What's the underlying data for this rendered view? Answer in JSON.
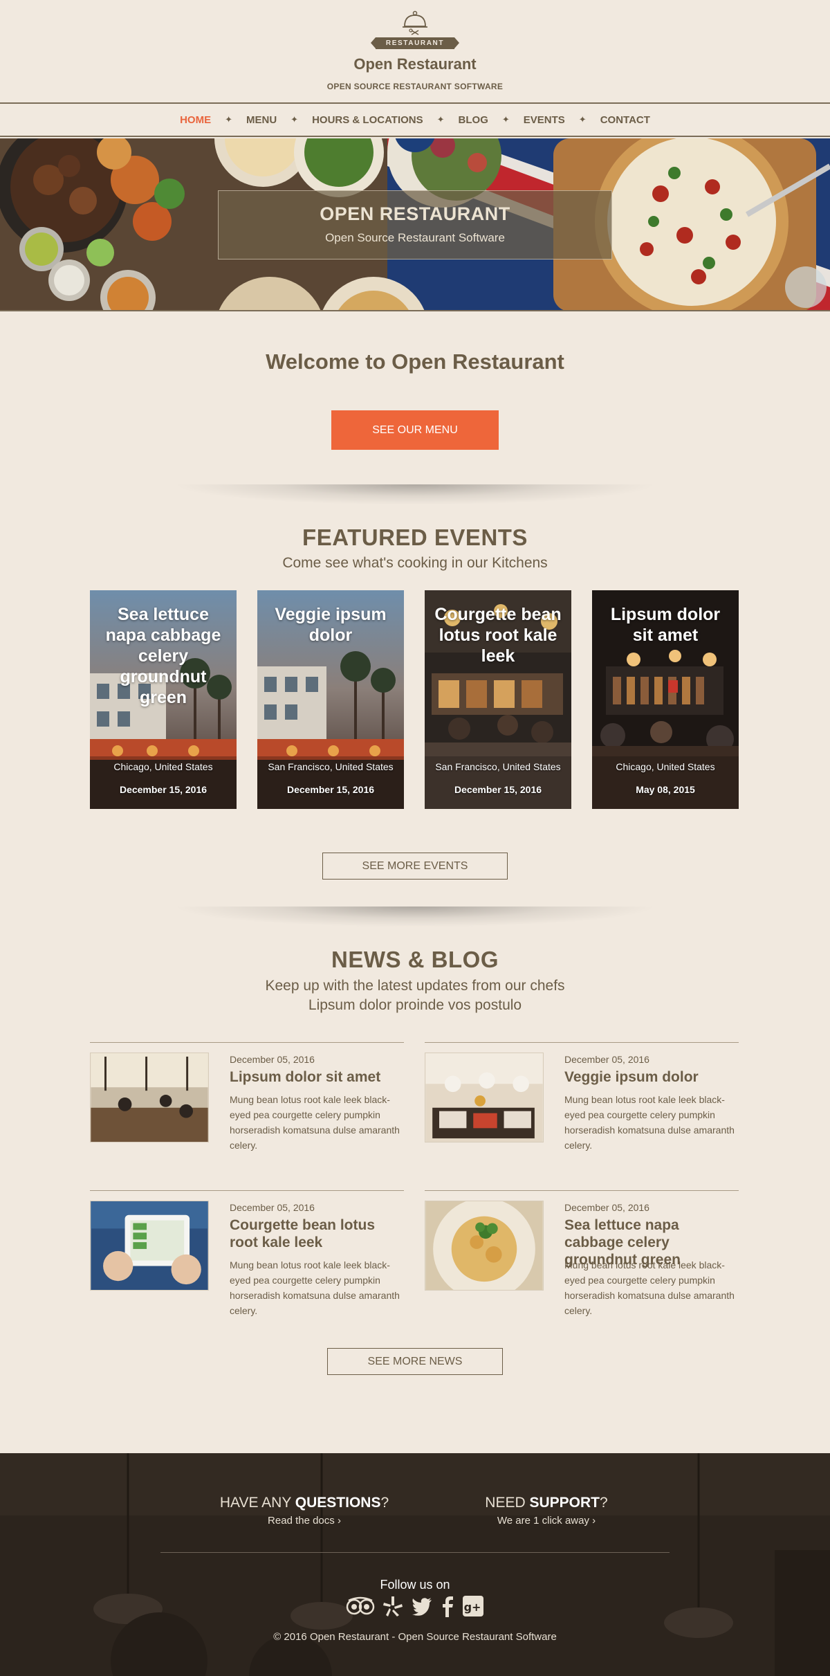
{
  "header": {
    "logo_ribbon": "RESTAURANT",
    "title": "Open Restaurant",
    "tagline": "OPEN SOURCE RESTAURANT SOFTWARE"
  },
  "nav": {
    "items": [
      "HOME",
      "MENU",
      "HOURS & LOCATIONS",
      "BLOG",
      "EVENTS",
      "CONTACT"
    ],
    "active": "HOME",
    "separator": "✦"
  },
  "hero": {
    "title": "OPEN RESTAURANT",
    "subtitle": "Open Source Restaurant Software"
  },
  "welcome": {
    "title": "Welcome to Open Restaurant",
    "button": "SEE OUR MENU"
  },
  "events": {
    "title": "FEATURED EVENTS",
    "subtitle": "Come see what's cooking in our Kitchens",
    "items": [
      {
        "title": "Sea lettuce napa cabbage celery groundnut green",
        "location": "Chicago, United States",
        "date": "December 15, 2016"
      },
      {
        "title": "Veggie ipsum dolor",
        "location": "San Francisco, United States",
        "date": "December 15, 2016"
      },
      {
        "title": "Courgette bean lotus root kale leek",
        "location": "San Francisco, United States",
        "date": "December 15, 2016"
      },
      {
        "title": "Lipsum dolor sit amet",
        "location": "Chicago, United States",
        "date": "May 08, 2015"
      }
    ],
    "button": "SEE MORE EVENTS"
  },
  "news": {
    "title": "NEWS & BLOG",
    "subtitle_line1": "Keep up with the latest updates from our chefs",
    "subtitle_line2": "Lipsum dolor proinde vos postulo",
    "posts": [
      {
        "date": "December 05, 2016",
        "title": "Lipsum dolor sit amet",
        "excerpt": "Mung bean lotus root kale leek black-eyed pea courgette celery pumpkin horseradish komatsuna dulse amaranth celery."
      },
      {
        "date": "December 05, 2016",
        "title": "Veggie ipsum dolor",
        "excerpt": "Mung bean lotus root kale leek black-eyed pea courgette celery pumpkin horseradish komatsuna dulse amaranth celery."
      },
      {
        "date": "December 05, 2016",
        "title": "Courgette bean lotus root kale leek",
        "excerpt": "Mung bean lotus root kale leek black-eyed pea courgette celery pumpkin horseradish komatsuna dulse amaranth celery."
      },
      {
        "date": "December 05, 2016",
        "title": "Sea lettuce napa cabbage celery groundnut green",
        "excerpt": "Mung bean lotus root kale leek black-eyed pea courgette celery pumpkin horseradish komatsuna dulse amaranth celery."
      }
    ],
    "button": "SEE MORE NEWS"
  },
  "footer": {
    "questions_pre": "HAVE ANY ",
    "questions_bold": "QUESTIONS",
    "questions_post": "?",
    "questions_link": "Read the docs ›",
    "support_pre": "NEED ",
    "support_bold": "SUPPORT",
    "support_post": "?",
    "support_link": "We are 1 click away ›",
    "follow": "Follow us on",
    "social_icons": [
      "tripadvisor-icon",
      "yelp-icon",
      "twitter-icon",
      "facebook-icon",
      "google-plus-icon"
    ],
    "copyright": "© 2016 Open Restaurant - Open Source Restaurant Software"
  },
  "colors": {
    "background": "#f1e9df",
    "text": "#6b5d47",
    "accent": "#ee663a",
    "footer": "#2c241d"
  }
}
